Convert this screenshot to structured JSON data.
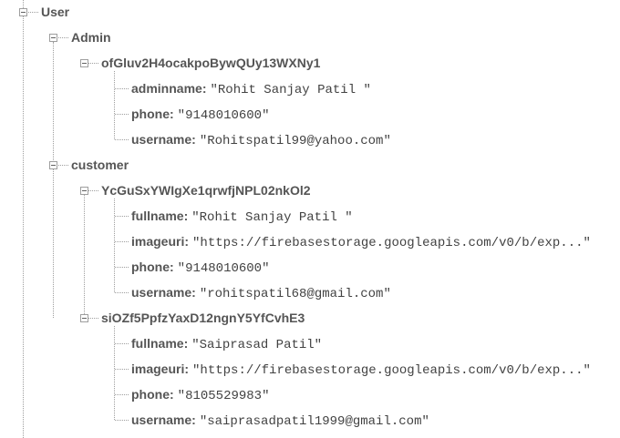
{
  "root": {
    "key": "User",
    "admin": {
      "key": "Admin",
      "record": {
        "key": "ofGluv2H4ocakpoBywQUy13WXNy1",
        "fields": [
          {
            "key": "adminname",
            "value": "\"Rohit Sanjay Patil \""
          },
          {
            "key": "phone",
            "value": "\"9148010600\""
          },
          {
            "key": "username",
            "value": "\"Rohitspatil99@yahoo.com\""
          }
        ]
      }
    },
    "customer": {
      "key": "customer",
      "records": [
        {
          "key": "YcGuSxYWIgXe1qrwfjNPL02nkOl2",
          "fields": [
            {
              "key": "fullname",
              "value": "\"Rohit Sanjay Patil \""
            },
            {
              "key": "imageuri",
              "value": "\"https://firebasestorage.googleapis.com/v0/b/exp...\""
            },
            {
              "key": "phone",
              "value": "\"9148010600\""
            },
            {
              "key": "username",
              "value": "\"rohitspatil68@gmail.com\""
            }
          ]
        },
        {
          "key": "siOZf5PpfzYaxD12ngnY5YfCvhE3",
          "fields": [
            {
              "key": "fullname",
              "value": "\"Saiprasad Patil\""
            },
            {
              "key": "imageuri",
              "value": "\"https://firebasestorage.googleapis.com/v0/b/exp...\""
            },
            {
              "key": "phone",
              "value": "\"8105529983\""
            },
            {
              "key": "username",
              "value": "\"saiprasadpatil1999@gmail.com\""
            }
          ]
        }
      ]
    }
  }
}
